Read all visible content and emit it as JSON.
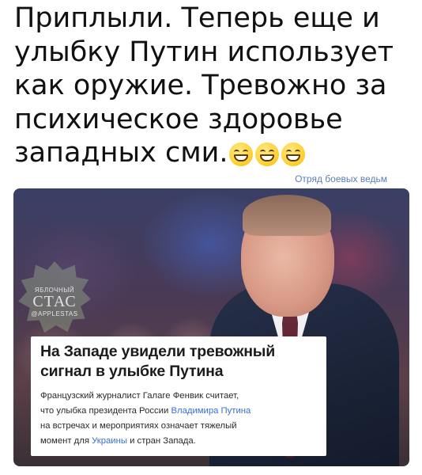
{
  "caption": {
    "lines": [
      "Приплыли. Теперь еще и",
      "улыбку Путин использует",
      "как оружие. Тревожно за",
      "психическое здоровье",
      "западных сми."
    ],
    "emoji_count": 3,
    "emoji_icon": "grinning-face-icon"
  },
  "source_label": "Отряд боевых ведьм",
  "watermark": {
    "line1": "ЯБЛОЧНЫЙ",
    "line2": "СТАС",
    "line3": "@APPLESTAS"
  },
  "news": {
    "title_line1": "На Западе увидели тревожный",
    "title_line2": "сигнал в улыбке Путина",
    "body": {
      "l1": "Французский журналист Галаге Фенвик считает,",
      "l2_pre": "что улыбка президента России ",
      "l2_link": "Владимира Путина",
      "l3": "на встречах и мероприятиях означает тяжелый",
      "l4_pre": "момент для ",
      "l4_link": "Украины",
      "l4_post": " и стран Запада."
    },
    "link_color": "#3b6fd1"
  }
}
